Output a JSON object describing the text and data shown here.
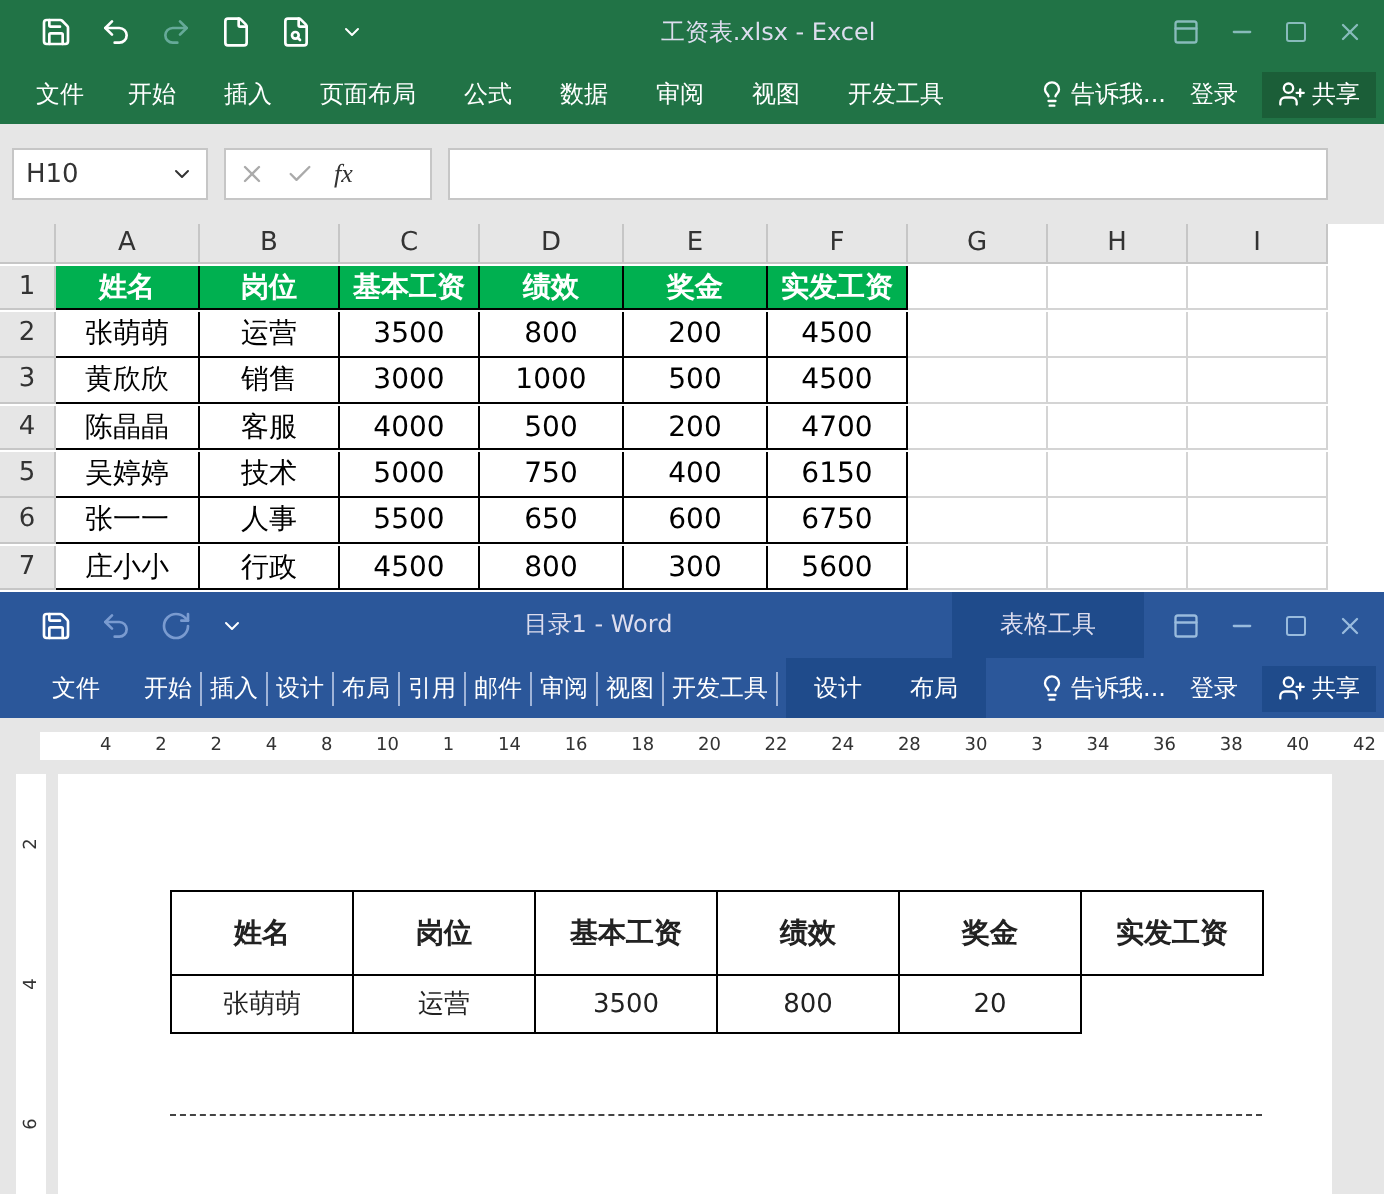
{
  "excel": {
    "title": "工资表.xlsx - Excel",
    "tabs": [
      "文件",
      "开始",
      "插入",
      "页面布局",
      "公式",
      "数据",
      "审阅",
      "视图",
      "开发工具"
    ],
    "tell_me": "告诉我...",
    "login": "登录",
    "share": "共享",
    "name_box": "H10",
    "fx": "fx",
    "row_numbers": [
      "1",
      "2",
      "3",
      "4",
      "5",
      "6",
      "7"
    ],
    "columns": [
      "A",
      "B",
      "C",
      "D",
      "E",
      "F",
      "G",
      "H",
      "I"
    ],
    "rows": [
      [
        "姓名",
        "岗位",
        "基本工资",
        "绩效",
        "奖金",
        "实发工资"
      ],
      [
        "张萌萌",
        "运营",
        "3500",
        "800",
        "200",
        "4500"
      ],
      [
        "黄欣欣",
        "销售",
        "3000",
        "1000",
        "500",
        "4500"
      ],
      [
        "陈晶晶",
        "客服",
        "4000",
        "500",
        "200",
        "4700"
      ],
      [
        "吴婷婷",
        "技术",
        "5000",
        "750",
        "400",
        "6150"
      ],
      [
        "张一一",
        "人事",
        "5500",
        "650",
        "600",
        "6750"
      ],
      [
        "庄小小",
        "行政",
        "4500",
        "800",
        "300",
        "5600"
      ]
    ]
  },
  "word": {
    "title": "目录1 - Word",
    "context_title": "表格工具",
    "tabs": [
      "文件",
      "开始",
      "插入",
      "设计",
      "布局",
      "引用",
      "邮件",
      "审阅",
      "视图",
      "开发工具"
    ],
    "context_tabs": [
      "设计",
      "布局"
    ],
    "tell_me": "告诉我...",
    "login": "登录",
    "share": "共享",
    "ruler": [
      "4",
      "2",
      "2",
      "4",
      "8",
      "10",
      "1",
      "14",
      "16",
      "18",
      "20",
      "22",
      "24",
      "28",
      "30",
      "3",
      "34",
      "36",
      "38",
      "40",
      "42"
    ],
    "vruler": [
      "2",
      "4",
      "6"
    ],
    "table": {
      "header": [
        "姓名",
        "岗位",
        "基本工资",
        "绩效",
        "奖金",
        "实发工资"
      ],
      "row": [
        "张萌萌",
        "运营",
        "3500",
        "800",
        "20"
      ]
    }
  }
}
